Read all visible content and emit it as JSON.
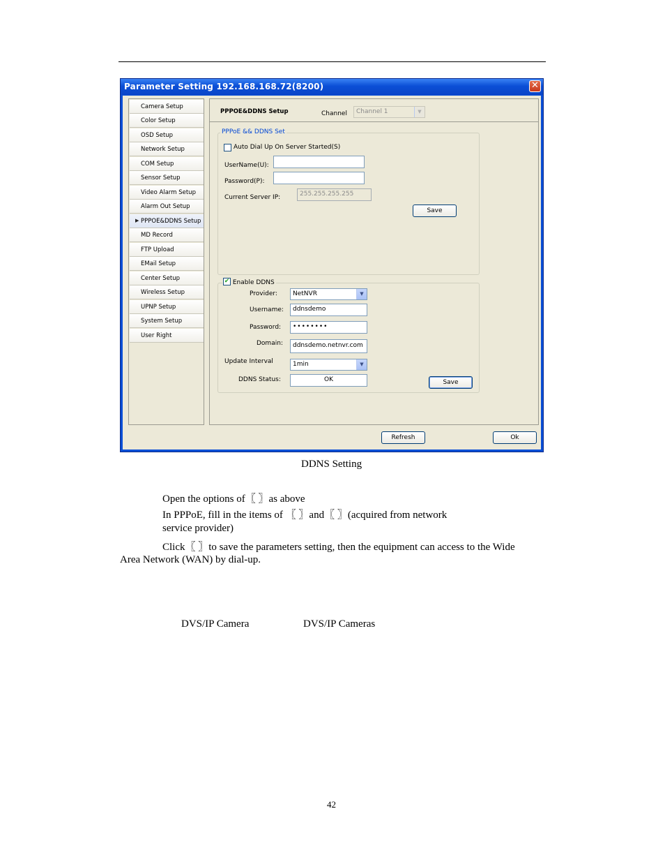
{
  "window": {
    "title": "Parameter Setting 192.168.168.72(8200)",
    "close_glyph": "✕"
  },
  "sidebar": {
    "items": [
      {
        "label": "Camera Setup"
      },
      {
        "label": "Color Setup"
      },
      {
        "label": "OSD Setup"
      },
      {
        "label": "Network Setup"
      },
      {
        "label": "COM Setup"
      },
      {
        "label": "Sensor Setup"
      },
      {
        "label": "Video Alarm Setup"
      },
      {
        "label": "Alarm Out Setup"
      },
      {
        "label": "PPPOE&DDNS Setup"
      },
      {
        "label": "MD Record"
      },
      {
        "label": "FTP Upload"
      },
      {
        "label": "EMail Setup"
      },
      {
        "label": "Center Setup"
      },
      {
        "label": "Wireless Setup"
      },
      {
        "label": "UPNP Setup"
      },
      {
        "label": "System Setup"
      },
      {
        "label": "User Right"
      }
    ],
    "selected_index": 8
  },
  "header": {
    "section_title": "PPPOE&DDNS Setup",
    "channel_label": "Channel",
    "channel_value": "Channel 1"
  },
  "pppoe": {
    "group_label": "PPPoE && DDNS Set",
    "auto_dial_label": "Auto Dial Up On Server Started(S)",
    "auto_dial_checked": false,
    "username_label": "UserName(U):",
    "username_value": "",
    "password_label": "Password(P):",
    "password_value": "",
    "server_ip_label": "Current Server IP:",
    "server_ip_value": "255.255.255.255",
    "save_label": "Save"
  },
  "ddns": {
    "enable_label": "Enable DDNS",
    "enable_checked": true,
    "provider_label": "Provider:",
    "provider_value": "NetNVR",
    "username_label": "Username:",
    "username_value": "ddnsdemo",
    "password_label": "Password:",
    "password_value": "••••••••",
    "domain_label": "Domain:",
    "domain_value": "ddnsdemo.netnvr.com",
    "interval_label": "Update Interval",
    "interval_value": "1min",
    "status_label": "DDNS Status:",
    "status_value": "OK",
    "save_label": "Save"
  },
  "footer": {
    "refresh_label": "Refresh",
    "ok_label": "Ok"
  },
  "document": {
    "caption": "DDNS Setting",
    "line1": "Open the options of〖                             〗as above",
    "line2": "In PPPoE, fill in the items of 〖               〗and〖              〗(acquired from network",
    "line3": "service provider)",
    "line4": "Click〖         〗to save the parameters setting, then the equipment can access to the Wide",
    "line5": "Area Network (WAN) by dial-up.",
    "line6a": "DVS/IP Camera",
    "line6b": "DVS/IP Cameras",
    "page_number": "42"
  }
}
